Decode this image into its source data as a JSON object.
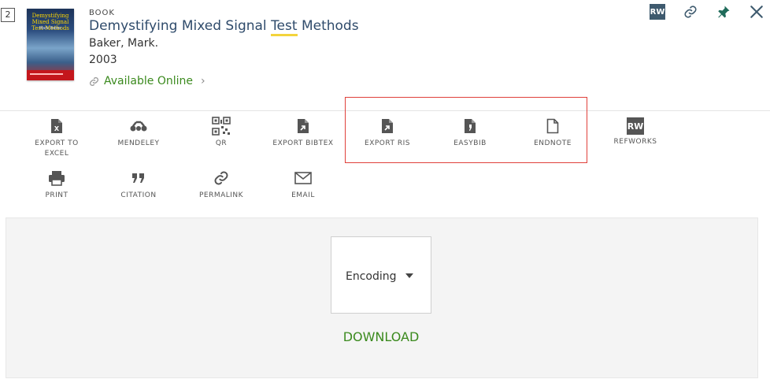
{
  "result": {
    "number": "2",
    "type": "BOOK",
    "title_before": "Demystifying Mixed Signal ",
    "title_highlight": "Test",
    "title_after": " Methods",
    "author": "Baker, Mark.",
    "year": "2003",
    "availability": "Available Online",
    "cover": {
      "title": "Demystifying Mixed Signal Test Methods",
      "author": "Mark Baker"
    }
  },
  "top_actions": {
    "refworks_badge": "RW"
  },
  "actions_row1": [
    {
      "label_line1": "EXPORT TO",
      "label_line2": "EXCEL",
      "icon": "excel-icon"
    },
    {
      "label_line1": "MENDELEY",
      "label_line2": "",
      "icon": "mendeley-icon"
    },
    {
      "label_line1": "QR",
      "label_line2": "",
      "icon": "qr-icon"
    },
    {
      "label_line1": "EXPORT BIBTEX",
      "label_line2": "",
      "icon": "file-export-icon"
    },
    {
      "label_line1": "EXPORT RIS",
      "label_line2": "",
      "icon": "file-export-icon"
    },
    {
      "label_line1": "EASYBIB",
      "label_line2": "",
      "icon": "easybib-icon"
    },
    {
      "label_line1": "ENDNOTE",
      "label_line2": "",
      "icon": "file-icon"
    },
    {
      "label_line1": "REFWORKS",
      "label_line2": "",
      "icon": "refworks-icon",
      "badge": "RW"
    }
  ],
  "actions_row2": [
    {
      "label_line1": "PRINT",
      "icon": "print-icon"
    },
    {
      "label_line1": "CITATION",
      "icon": "quote-icon"
    },
    {
      "label_line1": "PERMALINK",
      "icon": "link-icon"
    },
    {
      "label_line1": "EMAIL",
      "icon": "email-icon"
    }
  ],
  "export_panel": {
    "encoding_label": "Encoding",
    "download_label": "DOWNLOAD"
  },
  "colors": {
    "title": "#2f4b6b",
    "link_green": "#3b8a1e",
    "highlight_border": "#e0403b",
    "panel_bg": "#f4f4f4"
  }
}
